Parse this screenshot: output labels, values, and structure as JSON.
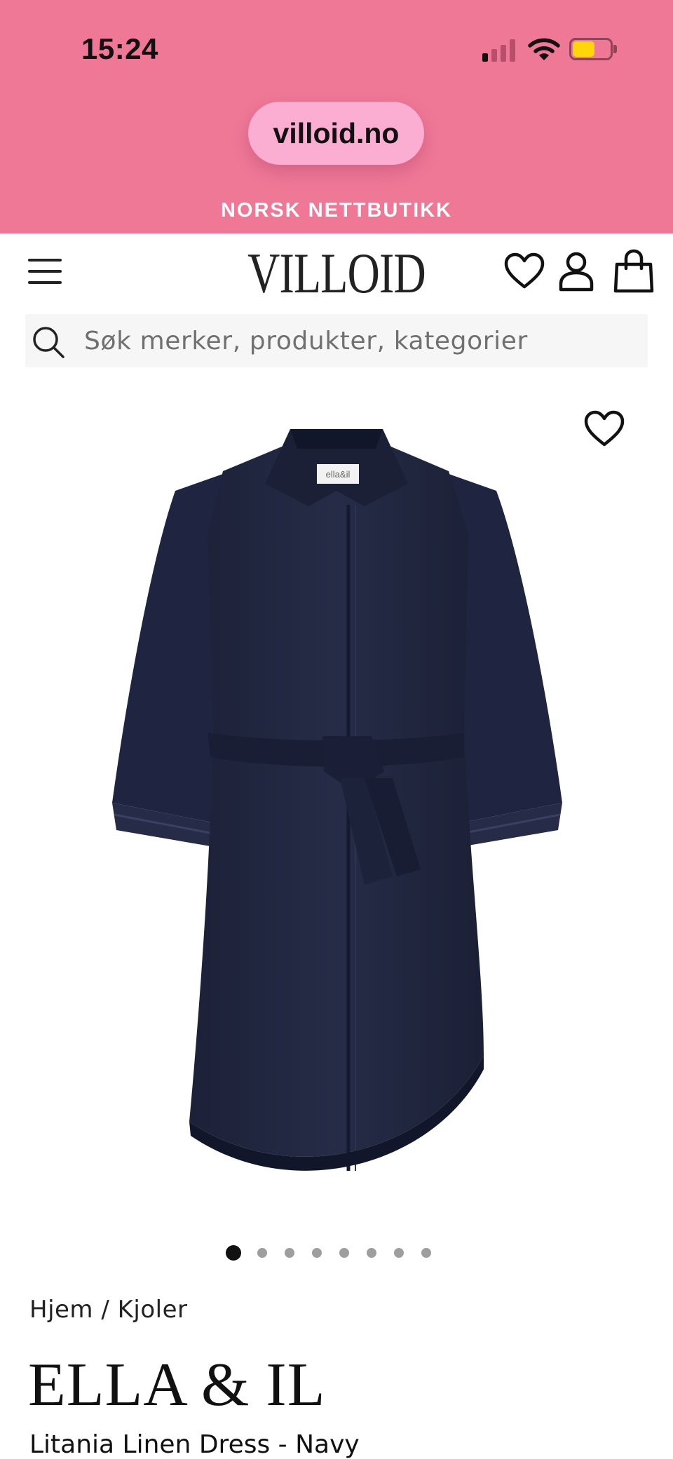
{
  "status_bar": {
    "time": "15:24",
    "signal_bars_active": 1,
    "signal_bars_total": 4,
    "battery_level": 0.6,
    "battery_color": "#ffd60a"
  },
  "browser": {
    "url": "villoid.no"
  },
  "promo_banner": {
    "text": "NORSK NETTBUTIKK",
    "background": "#ef7897"
  },
  "header": {
    "logo": "VILLOID",
    "icons": [
      "menu-icon",
      "heart-icon",
      "account-icon",
      "shopping-bag-icon"
    ]
  },
  "search": {
    "placeholder": "Søk merker, produkter, kategorier",
    "icon": "search-icon"
  },
  "gallery": {
    "image_subject": "navy linen shirt dress with belt",
    "label_on_garment": "ella&il",
    "active_slide": 1,
    "slide_count": 8,
    "favorite_icon": "heart-icon"
  },
  "product": {
    "breadcrumb": "Hjem / Kjoler",
    "brand": "ELLA & IL",
    "name": "Litania Linen Dress - Navy"
  }
}
